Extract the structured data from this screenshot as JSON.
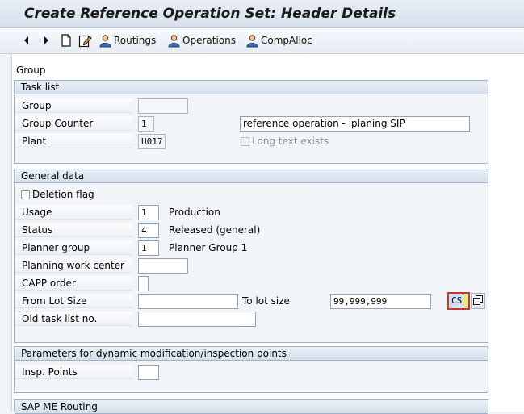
{
  "window": {
    "title": "Create Reference Operation Set: Header Details"
  },
  "toolbar": {
    "routings_label": "Routings",
    "operations_label": "Operations",
    "compalloc_label": "CompAlloc",
    "icons": [
      "back-arrow-icon",
      "forward-arrow-icon",
      "new-document-icon",
      "edit-icon",
      "routings-icon",
      "operations-icon",
      "compalloc-icon"
    ]
  },
  "page": {
    "heading": "Group"
  },
  "task_list": {
    "title": "Task list",
    "group_label": "Group",
    "group_value": "",
    "group_counter_label": "Group Counter",
    "group_counter_value": "1",
    "description_value": "reference operation - iplaning SIP",
    "plant_label": "Plant",
    "plant_value": "U017",
    "long_text_label": "Long text exists",
    "long_text_checked": false
  },
  "general_data": {
    "title": "General data",
    "deletion_flag_label": "Deletion flag",
    "deletion_flag_checked": false,
    "usage_label": "Usage",
    "usage_value": "1",
    "usage_text": "Production",
    "status_label": "Status",
    "status_value": "4",
    "status_text": "Released (general)",
    "planner_group_label": "Planner group",
    "planner_group_value": "1",
    "planner_group_text": "Planner Group 1",
    "planning_work_center_label": "Planning work center",
    "planning_work_center_value": "",
    "capp_order_label": "CAPP order",
    "capp_order_value": "",
    "from_lot_size_label": "From Lot Size",
    "from_lot_size_value": "",
    "to_lot_size_label": "To lot size",
    "to_lot_size_value": "99,999,999",
    "unit_value": "CS",
    "old_task_list_label": "Old task list no.",
    "old_task_list_value": ""
  },
  "dynamic_params": {
    "title": "Parameters for dynamic modification/inspection points",
    "insp_points_label": "Insp. Points",
    "insp_points_value": ""
  },
  "sap_me": {
    "title": "SAP ME Routing"
  },
  "colors": {
    "titlebar_bg": "#dde5ef",
    "group_border": "#9fb2c8",
    "focus_border": "#c0392b"
  }
}
